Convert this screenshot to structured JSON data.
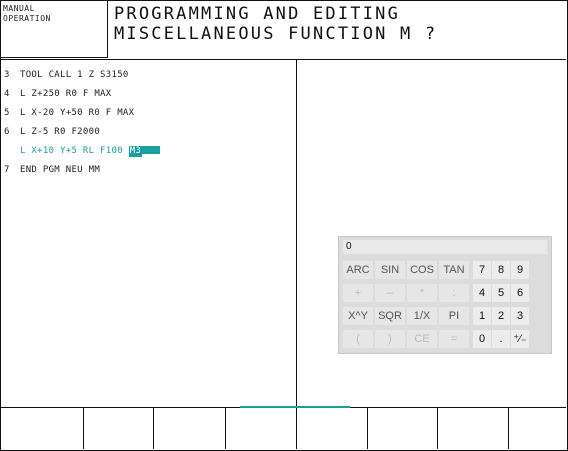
{
  "mode_label": "MANUAL\nOPERATION",
  "title": {
    "line1": "PROGRAMMING AND EDITING",
    "line2": "MISCELLANEOUS FUNCTION M ?"
  },
  "program": [
    {
      "num": "3",
      "text": "TOOL CALL 1 Z S3150"
    },
    {
      "num": "4",
      "text": "L Z+250 R0 F MAX"
    },
    {
      "num": "5",
      "text": "L X-20 Y+50 R0 F MAX"
    },
    {
      "num": "6",
      "text": "L Z-5 R0 F2000"
    },
    {
      "num": "",
      "text": "L X+10 Y+5 RL F100 ",
      "highlight": "M3",
      "active": true
    },
    {
      "num": "7",
      "text": "END PGM NEU MM"
    }
  ],
  "calculator": {
    "display": "0",
    "func_rows": [
      [
        "ARC",
        "SIN",
        "COS",
        "TAN"
      ],
      [
        "+",
        "–",
        "*",
        ":"
      ],
      [
        "X^Y",
        "SQR",
        "1/X",
        "PI"
      ],
      [
        "(",
        ")",
        "CE",
        "="
      ]
    ],
    "num_rows": [
      [
        "7",
        "8",
        "9"
      ],
      [
        "4",
        "5",
        "6"
      ],
      [
        "1",
        "2",
        "3"
      ],
      [
        "0",
        ".",
        "⁺⁄₋"
      ]
    ]
  },
  "softkeys": [
    "",
    "",
    "",
    "",
    "",
    "",
    "",
    ""
  ],
  "colors": {
    "accent": "#1aa0a0",
    "calc_bg": "#dcdcdc"
  }
}
